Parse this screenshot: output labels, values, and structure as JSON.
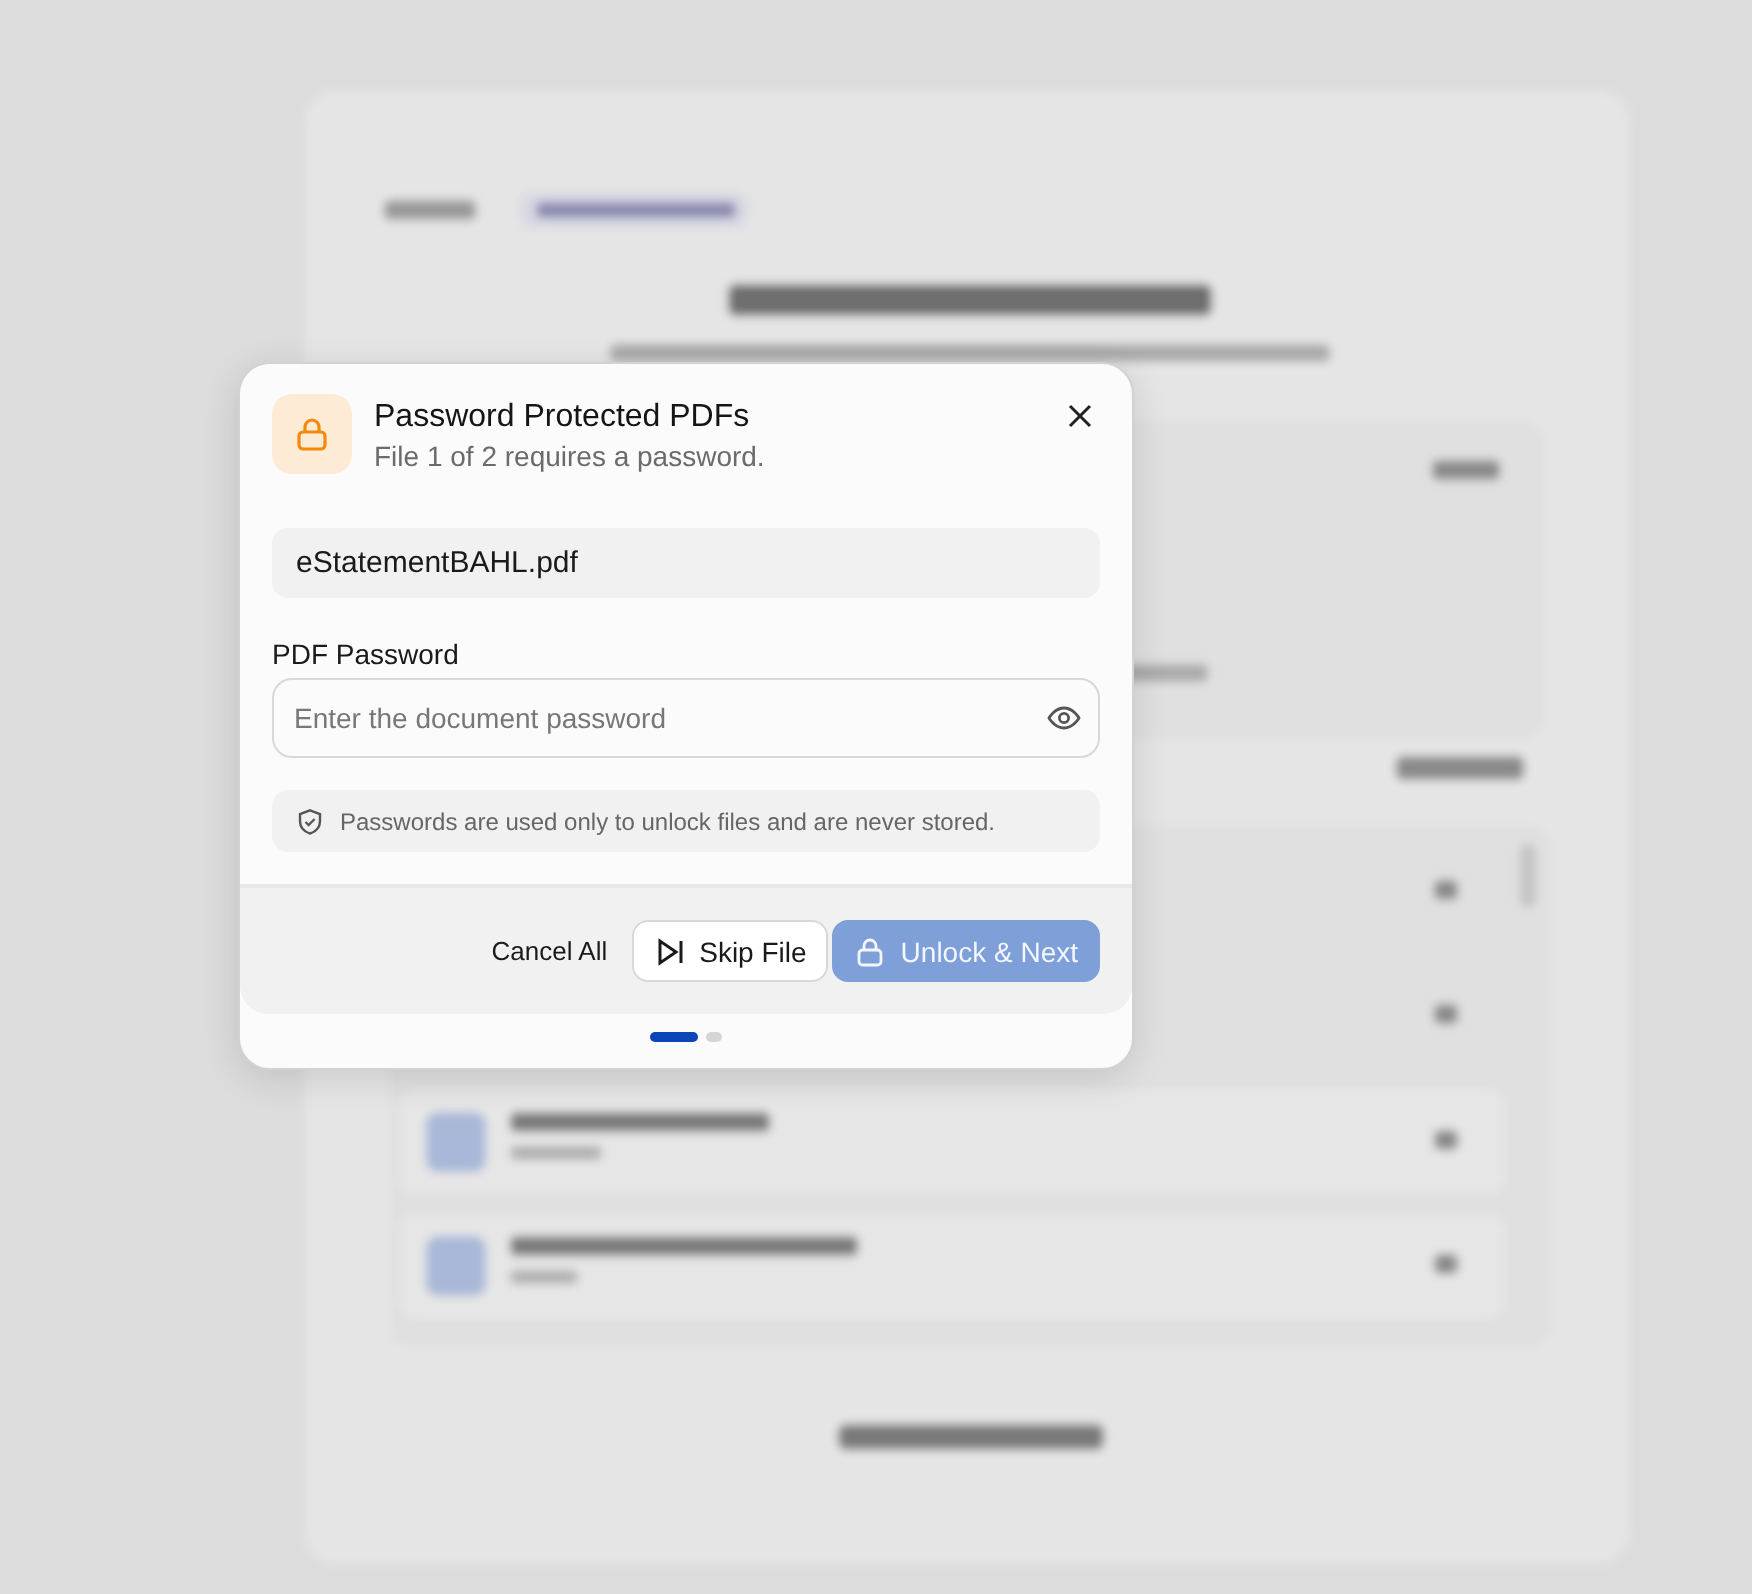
{
  "dialog": {
    "title": "Password Protected PDFs",
    "subtitle": "File 1 of 2 requires a password.",
    "file_name": "eStatementBAHL.pdf",
    "password": {
      "label": "PDF Password",
      "placeholder": "Enter the document password"
    },
    "note": "Passwords are used only to unlock files and are never stored.",
    "buttons": [
      {
        "label": "Cancel All",
        "kind": "text",
        "disabled": false
      },
      {
        "label": "Skip File",
        "kind": "skip",
        "disabled": false
      },
      {
        "label": "Unlock & Next",
        "kind": "unlock",
        "disabled": true
      }
    ],
    "steps": [
      {
        "selected": true
      },
      {
        "selected": false
      }
    ]
  }
}
